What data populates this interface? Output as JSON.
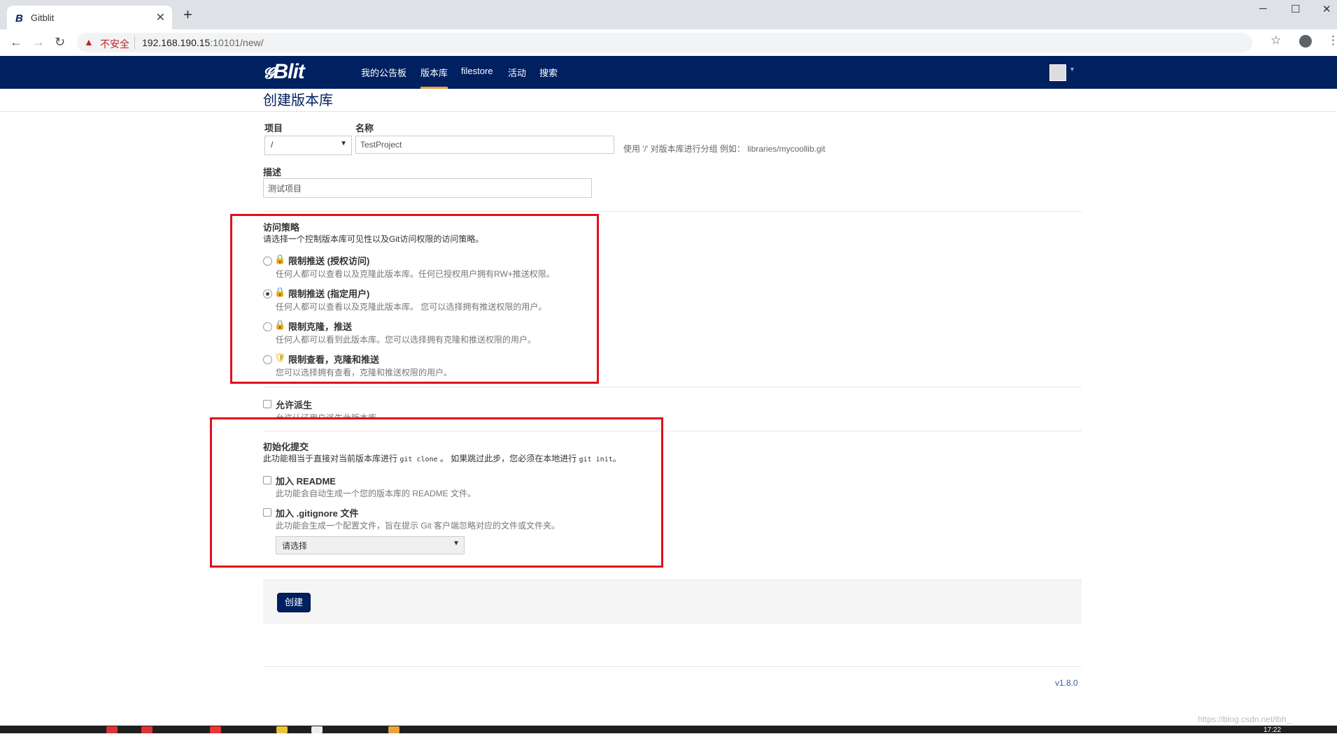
{
  "browser": {
    "tab_title": "Gitblit",
    "tab_favicon": "B",
    "new_tab": "+",
    "close": "✕",
    "insecure_label": "不安全",
    "url_host": "192.168.190.15",
    "url_rest": ":10101/new/",
    "window_controls": [
      "─",
      "☐",
      "✕"
    ]
  },
  "navbar": {
    "logo": "Blit",
    "logo_prefix": "𝓖",
    "links": [
      "我的公告板",
      "版本库",
      "filestore",
      "活动",
      "搜索"
    ],
    "active_link": "版本库"
  },
  "page": {
    "title": "创建版本库"
  },
  "form": {
    "project_label": "项目",
    "project_value": "/",
    "name_label": "名称",
    "name_value": "TestProject",
    "name_help": "使用 '/' 对版本库进行分组 例如： libraries/mycoollib.git",
    "desc_label": "描述",
    "desc_value": "测试项目",
    "access": {
      "title": "访问策略",
      "desc": "请选择一个控制版本库可见性以及Git访问权限的访问策略。",
      "options": [
        {
          "label": "限制推送 (授权访问)",
          "desc": "任何人都可以查看以及克隆此版本库。任何已授权用户拥有RW+推送权限。",
          "icon": "lock-icon",
          "checked": false
        },
        {
          "label": "限制推送 (指定用户)",
          "desc": "任何人都可以查看以及克隆此版本库。 您可以选择拥有推送权限的用户。",
          "icon": "lock-icon",
          "checked": true
        },
        {
          "label": "限制克隆，推送",
          "desc": "任何人都可以看到此版本库。您可以选择拥有克隆和推送权限的用户。",
          "icon": "lock-icon",
          "checked": false
        },
        {
          "label": "限制查看，克隆和推送",
          "desc": "您可以选择拥有查看，克隆和推送权限的用户。",
          "icon": "shield-icon",
          "checked": false
        }
      ]
    },
    "allow_forks_label": "允许派生",
    "allow_forks_desc": "允许认证用户派生此版本库",
    "init": {
      "title": "初始化提交",
      "desc_before": "此功能相当于直接对当前版本库进行",
      "cmd_clone": "git clone",
      "desc_middle": "。 如果跳过此步，您必须在本地进行",
      "cmd_init": "git init",
      "desc_after": "。",
      "readme_label": "加入 README",
      "readme_desc": "此功能会自动生成一个您的版本库的 README 文件。",
      "gitignore_label": "加入 .gitignore 文件",
      "gitignore_desc": "此功能会生成一个配置文件，旨在提示 Git 客户端忽略对应的文件或文件夹。",
      "gitignore_select": "请选择"
    },
    "create_button": "创建"
  },
  "footer": {
    "version": "v1.8.0",
    "watermark": "https://blog.csdn.net/lbh_"
  },
  "taskbar": {
    "clock": "17:22"
  },
  "colors": {
    "navbar": "#002060",
    "highlight": "#e0101b",
    "active_tab": "#e8a33d"
  }
}
